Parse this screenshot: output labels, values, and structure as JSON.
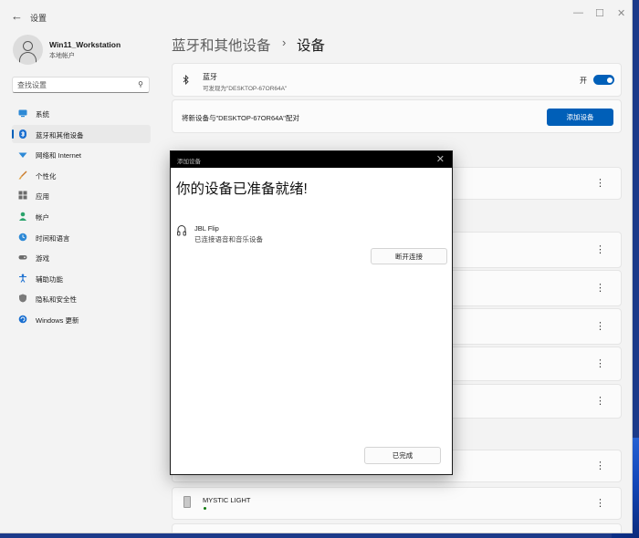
{
  "window": {
    "title": "设置",
    "back_icon": "back-arrow-icon"
  },
  "user": {
    "name": "Win11_Workstation",
    "account_type": "本地帐户"
  },
  "search": {
    "placeholder": "查找设置"
  },
  "sidebar": {
    "items": [
      {
        "label": "系统",
        "icon": "system-icon"
      },
      {
        "label": "蓝牙和其他设备",
        "icon": "bluetooth-icon",
        "active": true
      },
      {
        "label": "网络和 Internet",
        "icon": "network-icon"
      },
      {
        "label": "个性化",
        "icon": "personalization-icon"
      },
      {
        "label": "应用",
        "icon": "apps-icon"
      },
      {
        "label": "帐户",
        "icon": "account-icon"
      },
      {
        "label": "时间和语言",
        "icon": "time-language-icon"
      },
      {
        "label": "游戏",
        "icon": "gaming-icon"
      },
      {
        "label": "辅助功能",
        "icon": "accessibility-icon"
      },
      {
        "label": "隐私和安全性",
        "icon": "privacy-icon"
      },
      {
        "label": "Windows 更新",
        "icon": "windows-update-icon"
      }
    ]
  },
  "breadcrumb": {
    "parent": "蓝牙和其他设备",
    "separator": "›",
    "current": "设备"
  },
  "bluetooth": {
    "title": "蓝牙",
    "subtitle": "可发现为\"DESKTOP-67OR64A\"",
    "toggle_label": "开",
    "enabled": true
  },
  "pairing": {
    "label": "将新设备与\"DESKTOP-67OR64A\"配对",
    "add_button": "添加设备"
  },
  "devices": {
    "bottom_device": {
      "name": "MYSTIC LIGHT",
      "connected": true
    }
  },
  "dialog": {
    "title": "添加设备",
    "heading": "你的设备已准备就绪!",
    "device_name": "JBL Flip",
    "device_status": "已连接语音和音乐设备",
    "disconnect_button": "断开连接",
    "done_button": "已完成"
  }
}
